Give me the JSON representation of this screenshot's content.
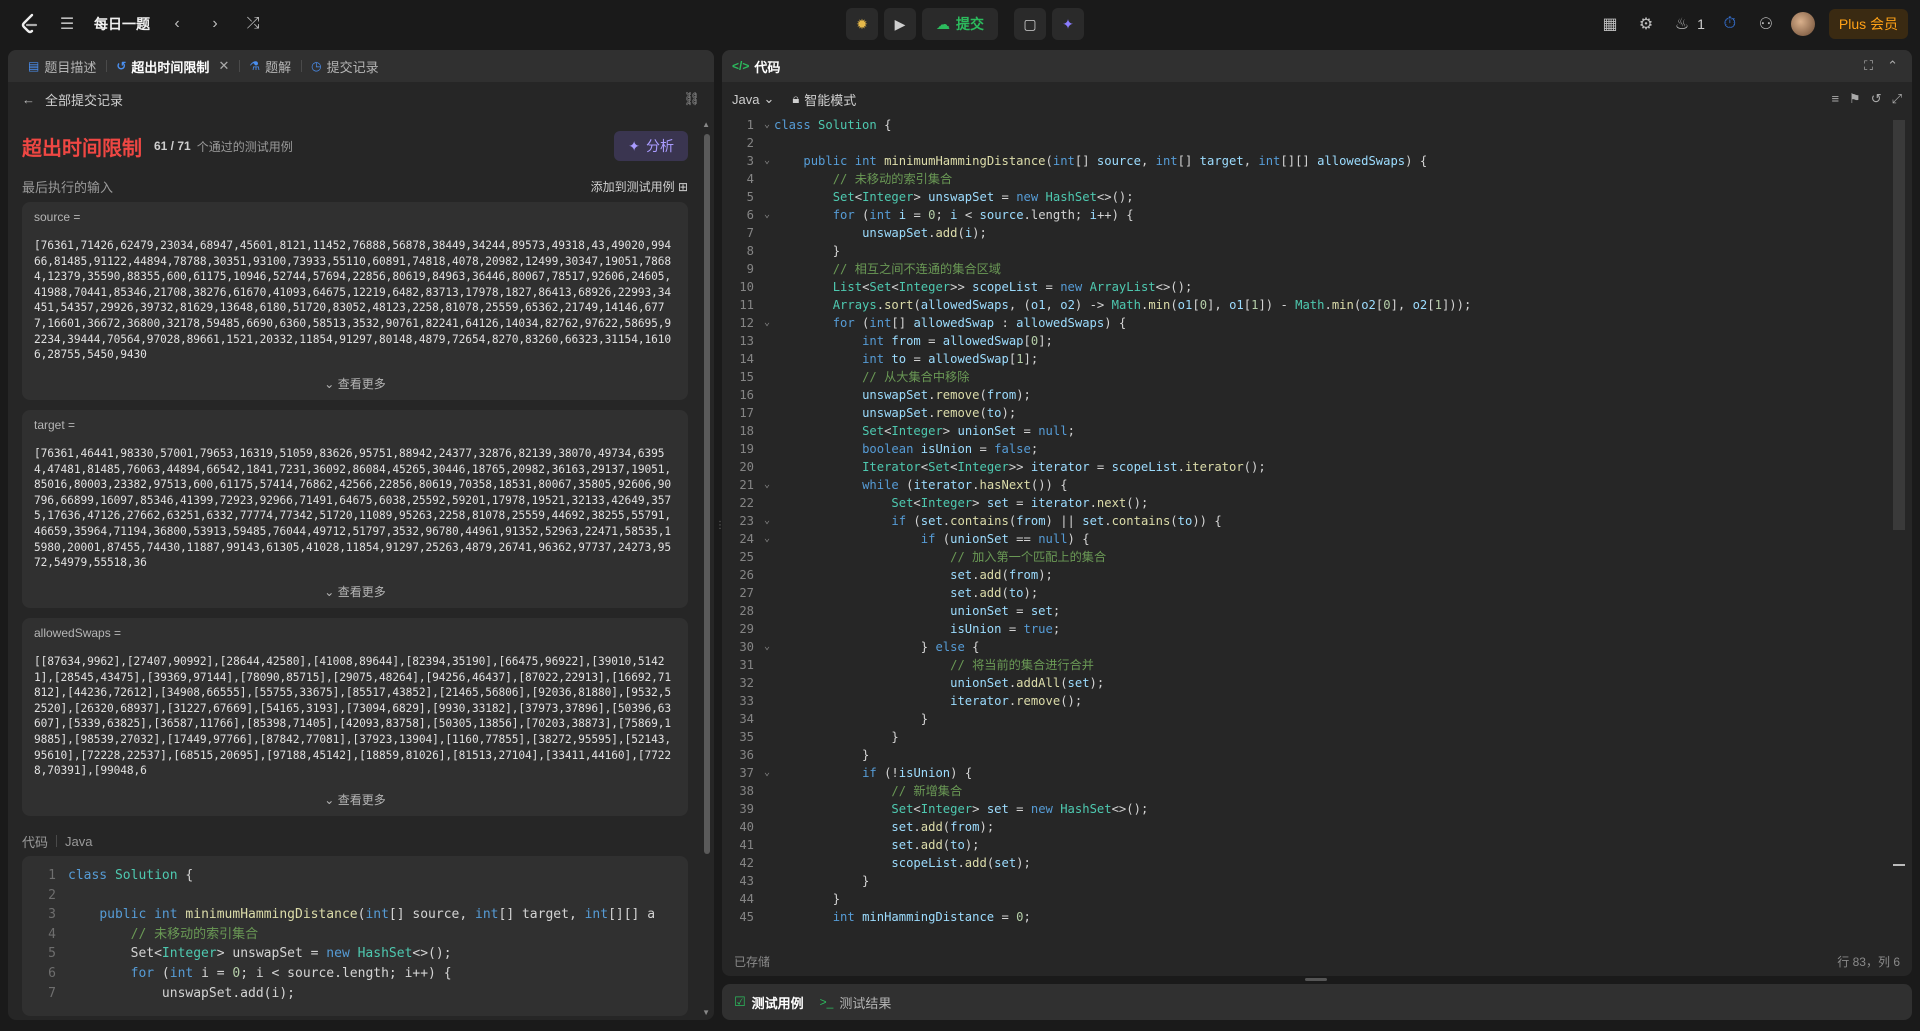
{
  "topbar": {
    "title": "每日一题",
    "submit_label": "提交",
    "fire_count": "1",
    "plus_label": "Plus 会员"
  },
  "left": {
    "tabs": [
      {
        "label": "题目描述",
        "icon": "document-icon"
      },
      {
        "label": "超出时间限制",
        "icon": "history-icon"
      },
      {
        "label": "题解",
        "icon": "flask-icon"
      },
      {
        "label": "提交记录",
        "icon": "clock-icon"
      }
    ],
    "back_label": "全部提交记录",
    "status": "超出时间限制",
    "passed": "61 / 71",
    "passed_note": "个通过的测试用例",
    "analyze_label": "分析",
    "last_input_label": "最后执行的输入",
    "add_testcase_label": "添加到测试用例",
    "inputs": [
      {
        "label": "source =",
        "value": "[76361,71426,62479,23034,68947,45601,8121,11452,76888,56878,38449,34244,89573,49318,43,49020,99466,81485,91122,44894,78788,30351,93100,73933,55110,60891,74818,4078,20982,12499,30347,19051,78684,12379,35590,88355,600,61175,10946,52744,57694,22856,80619,84963,36446,80067,78517,92606,24605,41988,70441,85346,21708,38276,61670,41093,64675,12219,6482,83713,17978,1827,86413,68926,22993,34451,54357,29926,39732,81629,13648,6180,51720,83052,48123,2258,81078,25559,65362,21749,14146,6777,16601,36672,36800,32178,59485,6690,6360,58513,3532,90761,82241,64126,14034,82762,97622,58695,92234,39444,70564,97028,89661,1521,20332,11854,91297,80148,4879,72654,8270,83260,66323,31154,16106,28755,5450,9430",
        "more": "查看更多"
      },
      {
        "label": "target =",
        "value": "[76361,46441,98330,57001,79653,16319,51059,83626,95751,88942,24377,32876,82139,38070,49734,63954,47481,81485,76063,44894,66542,1841,7231,36092,86084,45265,30446,18765,20982,36163,29137,19051,85016,80003,23382,97513,600,61175,57414,76862,42566,22856,80619,70358,18531,80067,35805,92606,90796,66899,16097,85346,41399,72923,92966,71491,64675,6038,25592,59201,17978,19521,32133,42649,3575,17636,47126,27662,63251,6332,77774,77342,51720,11089,95263,2258,81078,25559,44692,38255,55791,46659,35964,71194,36800,53913,59485,76044,49712,51797,3532,96780,44961,91352,52963,22471,58535,15980,20001,87455,74430,11887,99143,61305,41028,11854,91297,25263,4879,26741,96362,97737,24273,9572,54979,55518,36",
        "more": "查看更多"
      },
      {
        "label": "allowedSwaps =",
        "value": "[[87634,9962],[27407,90992],[28644,42580],[41008,89644],[82394,35190],[66475,96922],[39010,51421],[28545,43475],[39369,97144],[78090,85715],[29075,48264],[94256,46437],[87022,22913],[16692,71812],[44236,72612],[34908,66555],[55755,33675],[85517,43852],[21465,56806],[92036,81880],[9532,52520],[26320,68937],[31227,67669],[54165,3193],[73094,6829],[9930,33182],[37973,37896],[50396,63607],[5339,63825],[36587,11766],[85398,71405],[42093,83758],[50305,13856],[70203,38873],[75869,19885],[98539,27032],[17449,97766],[87842,77081],[37923,13904],[1160,77855],[38272,95595],[52143,95610],[72228,22537],[68515,20695],[97188,45142],[18859,81026],[81513,27104],[33411,44160],[77228,70391],[99048,6",
        "more": "查看更多"
      }
    ],
    "code_label": "代码",
    "code_lang": "Java",
    "code_preview": [
      {
        "n": "1",
        "html": "<span class='k'>class</span> <span class='t'>Solution</span> {"
      },
      {
        "n": "2",
        "html": ""
      },
      {
        "n": "3",
        "html": "    <span class='k'>public</span> <span class='k'>int</span> <span class='f'>minimumHammingDistance</span>(<span class='k'>int</span>[] source, <span class='k'>int</span>[] target, <span class='k'>int</span>[][] a"
      },
      {
        "n": "4",
        "html": "        <span class='c'>// 未移动的索引集合</span>"
      },
      {
        "n": "5",
        "html": "        Set&lt;<span class='t'>Integer</span>&gt; unswapSet = <span class='k'>new</span> <span class='t'>HashSet</span>&lt;&gt;();"
      },
      {
        "n": "6",
        "html": "        <span class='k'>for</span> (<span class='k'>int</span> i = <span class='n'>0</span>; i &lt; source.length; i++) {"
      },
      {
        "n": "7",
        "html": "            unswapSet.add(i);"
      }
    ]
  },
  "right": {
    "title": "代码",
    "lang": "Java",
    "mode": "智能模式",
    "saved": "已存储",
    "cursor": "行 83，列 6",
    "lines": [
      {
        "n": "1",
        "fold": "⌄",
        "html": "<span class='k'>class</span> <span class='t'>Solution</span> {"
      },
      {
        "n": "2",
        "fold": "",
        "html": ""
      },
      {
        "n": "3",
        "fold": "⌄",
        "html": "    <span class='k'>public</span> <span class='k'>int</span> <span class='f'>minimumHammingDistance</span>(<span class='k'>int</span>[] <span class='v'>source</span>, <span class='k'>int</span>[] <span class='v'>target</span>, <span class='k'>int</span>[][] <span class='v'>allowedSwaps</span>) {"
      },
      {
        "n": "4",
        "fold": "",
        "html": "        <span class='c'>// 未移动的索引集合</span>"
      },
      {
        "n": "5",
        "fold": "",
        "html": "        <span class='t'>Set</span>&lt;<span class='t'>Integer</span>&gt; <span class='v'>unswapSet</span> = <span class='k'>new</span> <span class='t'>HashSet</span>&lt;&gt;();"
      },
      {
        "n": "6",
        "fold": "⌄",
        "html": "        <span class='k'>for</span> (<span class='k'>int</span> <span class='v'>i</span> = <span class='n'>0</span>; <span class='v'>i</span> &lt; <span class='v'>source</span>.length; <span class='v'>i</span>++) {"
      },
      {
        "n": "7",
        "fold": "",
        "html": "            <span class='v'>unswapSet</span>.<span class='f'>add</span>(<span class='v'>i</span>);"
      },
      {
        "n": "8",
        "fold": "",
        "html": "        }"
      },
      {
        "n": "9",
        "fold": "",
        "html": "        <span class='c'>// 相互之间不连通的集合区域</span>"
      },
      {
        "n": "10",
        "fold": "",
        "html": "        <span class='t'>List</span>&lt;<span class='t'>Set</span>&lt;<span class='t'>Integer</span>&gt;&gt; <span class='v'>scopeList</span> = <span class='k'>new</span> <span class='t'>ArrayList</span>&lt;&gt;();"
      },
      {
        "n": "11",
        "fold": "",
        "html": "        <span class='t'>Arrays</span>.<span class='f'>sort</span>(<span class='v'>allowedSwaps</span>, (<span class='v'>o1</span>, <span class='v'>o2</span>) -&gt; <span class='t'>Math</span>.<span class='f'>min</span>(<span class='v'>o1</span>[<span class='n'>0</span>], <span class='v'>o1</span>[<span class='n'>1</span>]) - <span class='t'>Math</span>.<span class='f'>min</span>(<span class='v'>o2</span>[<span class='n'>0</span>], <span class='v'>o2</span>[<span class='n'>1</span>]));"
      },
      {
        "n": "12",
        "fold": "⌄",
        "html": "        <span class='k'>for</span> (<span class='k'>int</span>[] <span class='v'>allowedSwap</span> : <span class='v'>allowedSwaps</span>) {"
      },
      {
        "n": "13",
        "fold": "",
        "html": "            <span class='k'>int</span> <span class='v'>from</span> = <span class='v'>allowedSwap</span>[<span class='n'>0</span>];"
      },
      {
        "n": "14",
        "fold": "",
        "html": "            <span class='k'>int</span> <span class='v'>to</span> = <span class='v'>allowedSwap</span>[<span class='n'>1</span>];"
      },
      {
        "n": "15",
        "fold": "",
        "html": "            <span class='c'>// 从大集合中移除</span>"
      },
      {
        "n": "16",
        "fold": "",
        "html": "            <span class='v'>unswapSet</span>.<span class='f'>remove</span>(<span class='v'>from</span>);"
      },
      {
        "n": "17",
        "fold": "",
        "html": "            <span class='v'>unswapSet</span>.<span class='f'>remove</span>(<span class='v'>to</span>);"
      },
      {
        "n": "18",
        "fold": "",
        "html": "            <span class='t'>Set</span>&lt;<span class='t'>Integer</span>&gt; <span class='v'>unionSet</span> = <span class='k'>null</span>;"
      },
      {
        "n": "19",
        "fold": "",
        "html": "            <span class='k'>boolean</span> <span class='v'>isUnion</span> = <span class='k'>false</span>;"
      },
      {
        "n": "20",
        "fold": "",
        "html": "            <span class='t'>Iterator</span>&lt;<span class='t'>Set</span>&lt;<span class='t'>Integer</span>&gt;&gt; <span class='v'>iterator</span> = <span class='v'>scopeList</span>.<span class='f'>iterator</span>();"
      },
      {
        "n": "21",
        "fold": "⌄",
        "html": "            <span class='k'>while</span> (<span class='v'>iterator</span>.<span class='f'>hasNext</span>()) {"
      },
      {
        "n": "22",
        "fold": "",
        "html": "                <span class='t'>Set</span>&lt;<span class='t'>Integer</span>&gt; <span class='v'>set</span> = <span class='v'>iterator</span>.<span class='f'>next</span>();"
      },
      {
        "n": "23",
        "fold": "⌄",
        "html": "                <span class='k'>if</span> (<span class='v'>set</span>.<span class='f'>contains</span>(<span class='v'>from</span>) || <span class='v'>set</span>.<span class='f'>contains</span>(<span class='v'>to</span>)) {"
      },
      {
        "n": "24",
        "fold": "⌄",
        "html": "                    <span class='k'>if</span> (<span class='v'>unionSet</span> == <span class='k'>null</span>) {"
      },
      {
        "n": "25",
        "fold": "",
        "html": "                        <span class='c'>// 加入第一个匹配上的集合</span>"
      },
      {
        "n": "26",
        "fold": "",
        "html": "                        <span class='v'>set</span>.<span class='f'>add</span>(<span class='v'>from</span>);"
      },
      {
        "n": "27",
        "fold": "",
        "html": "                        <span class='v'>set</span>.<span class='f'>add</span>(<span class='v'>to</span>);"
      },
      {
        "n": "28",
        "fold": "",
        "html": "                        <span class='v'>unionSet</span> = <span class='v'>set</span>;"
      },
      {
        "n": "29",
        "fold": "",
        "html": "                        <span class='v'>isUnion</span> = <span class='k'>true</span>;"
      },
      {
        "n": "30",
        "fold": "⌄",
        "html": "                    } <span class='k'>else</span> {"
      },
      {
        "n": "31",
        "fold": "",
        "html": "                        <span class='c'>// 将当前的集合进行合并</span>"
      },
      {
        "n": "32",
        "fold": "",
        "html": "                        <span class='v'>unionSet</span>.<span class='f'>addAll</span>(<span class='v'>set</span>);"
      },
      {
        "n": "33",
        "fold": "",
        "html": "                        <span class='v'>iterator</span>.<span class='f'>remove</span>();"
      },
      {
        "n": "34",
        "fold": "",
        "html": "                    }"
      },
      {
        "n": "35",
        "fold": "",
        "html": "                }"
      },
      {
        "n": "36",
        "fold": "",
        "html": "            }"
      },
      {
        "n": "37",
        "fold": "⌄",
        "html": "            <span class='k'>if</span> (!<span class='v'>isUnion</span>) {"
      },
      {
        "n": "38",
        "fold": "",
        "html": "                <span class='c'>// 新增集合</span>"
      },
      {
        "n": "39",
        "fold": "",
        "html": "                <span class='t'>Set</span>&lt;<span class='t'>Integer</span>&gt; <span class='v'>set</span> = <span class='k'>new</span> <span class='t'>HashSet</span>&lt;&gt;();"
      },
      {
        "n": "40",
        "fold": "",
        "html": "                <span class='v'>set</span>.<span class='f'>add</span>(<span class='v'>from</span>);"
      },
      {
        "n": "41",
        "fold": "",
        "html": "                <span class='v'>set</span>.<span class='f'>add</span>(<span class='v'>to</span>);"
      },
      {
        "n": "42",
        "fold": "",
        "html": "                <span class='v'>scopeList</span>.<span class='f'>add</span>(<span class='v'>set</span>);"
      },
      {
        "n": "43",
        "fold": "",
        "html": "            }"
      },
      {
        "n": "44",
        "fold": "",
        "html": "        }"
      },
      {
        "n": "45",
        "fold": "",
        "html": "        <span class='k'>int</span> <span class='v'>minHammingDistance</span> = <span class='n'>0</span>;"
      }
    ]
  },
  "bottom": {
    "tabs": [
      {
        "label": "测试用例"
      },
      {
        "label": "测试结果"
      }
    ]
  }
}
